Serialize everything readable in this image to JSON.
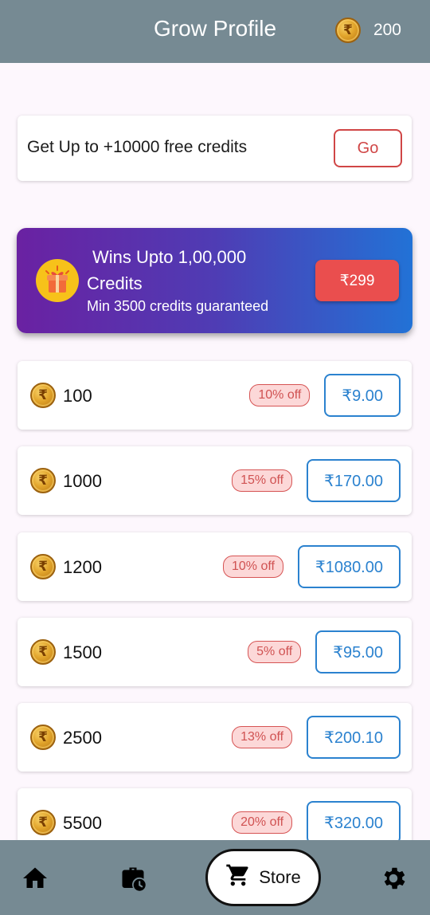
{
  "header": {
    "title": "Grow Profile",
    "balance": "200",
    "coin_icon": "rupee-coin-icon"
  },
  "free_credits": {
    "text": "Get Up to +10000 free credits",
    "button": "Go"
  },
  "promo": {
    "title_line1": "Wins Upto 1,00,000",
    "title_line2": "Credits",
    "subtitle": "Min 3500 credits guaranteed",
    "button": "₹299",
    "icon": "gift-icon"
  },
  "packs": [
    {
      "amount": "100",
      "discount": "10% off",
      "price": "₹9.00"
    },
    {
      "amount": "1000",
      "discount": "15% off",
      "price": "₹170.00"
    },
    {
      "amount": "1200",
      "discount": "10% off",
      "price": "₹1080.00"
    },
    {
      "amount": "1500",
      "discount": "5% off",
      "price": "₹95.00"
    },
    {
      "amount": "2500",
      "discount": "13% off",
      "price": "₹200.10"
    },
    {
      "amount": "5500",
      "discount": "20% off",
      "price": "₹320.00"
    }
  ],
  "nav": {
    "home_icon": "home-icon",
    "history_icon": "history-icon",
    "store_label": "Store",
    "store_icon": "cart-icon",
    "settings_icon": "gear-icon"
  },
  "colors": {
    "app_bar": "#768a93",
    "accent_red": "#d04646",
    "accent_blue": "#2b82cf"
  }
}
